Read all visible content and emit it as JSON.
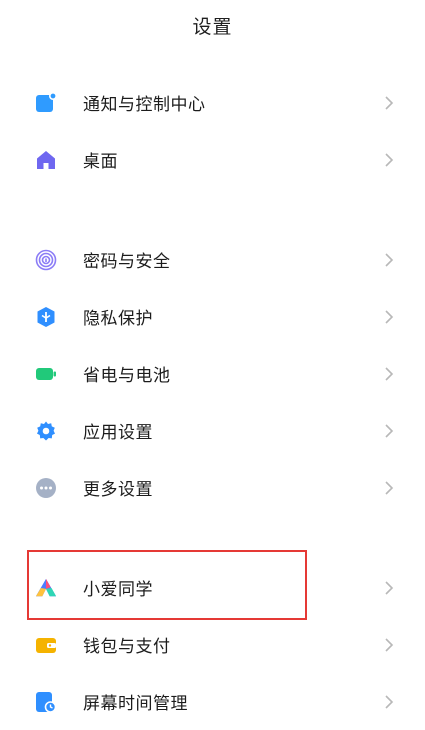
{
  "header": {
    "title": "设置"
  },
  "groups": [
    [
      {
        "key": "notifications",
        "label": "通知与控制中心",
        "icon": "notification-icon",
        "color": "#2f9bff"
      },
      {
        "key": "desktop",
        "label": "桌面",
        "icon": "home-icon",
        "color": "#6f67f0"
      }
    ],
    [
      {
        "key": "password",
        "label": "密码与安全",
        "icon": "fingerprint-icon",
        "color": "#8b7cf6"
      },
      {
        "key": "privacy",
        "label": "隐私保护",
        "icon": "shield-icon",
        "color": "#2f8fff"
      },
      {
        "key": "battery",
        "label": "省电与电池",
        "icon": "battery-icon",
        "color": "#21c97a"
      },
      {
        "key": "apps",
        "label": "应用设置",
        "icon": "gear-icon",
        "color": "#2f8fff"
      },
      {
        "key": "more",
        "label": "更多设置",
        "icon": "more-icon",
        "color": "#a5b1c6"
      }
    ],
    [
      {
        "key": "xiaoai",
        "label": "小爱同学",
        "icon": "xiaoai-icon",
        "color": "#4e7cff"
      },
      {
        "key": "wallet",
        "label": "钱包与支付",
        "icon": "wallet-icon",
        "color": "#f5b300"
      },
      {
        "key": "screentime",
        "label": "屏幕时间管理",
        "icon": "screen-time-icon",
        "color": "#2f8fff"
      }
    ]
  ],
  "highlight_color": "#e53935"
}
